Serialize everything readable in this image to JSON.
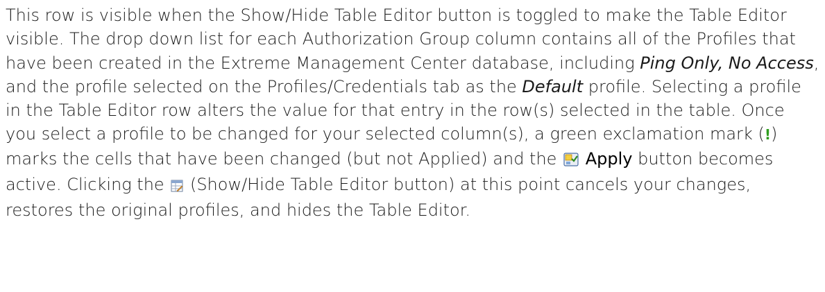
{
  "paragraph": {
    "s1": "This row is visible when the Show/Hide Table Editor button is toggled to make the Table Editor visible. The drop down list for each Authorization Group column contains all of the Profiles that have been created in the Extreme Management Center database, including ",
    "ping_only": "Ping Only, No Access",
    "s2": ", and the profile selected on the Profiles/Credentials tab as the ",
    "default_word": "Default",
    "s3": " profile. Selecting a profile in the Table Editor row alters the value for that entry in the row(s) selected in the table. Once you select a profile to be changed for your selected column(s), a green exclamation mark (",
    "exclamation": "!",
    "s4": ") marks the cells that have been changed (but not Applied) and the ",
    "apply_label": "Apply",
    "s5": " button becomes active. Clicking the ",
    "s6": " (Show/Hide Table Editor button) at this point cancels your changes, restores the original profiles, and hides the Table Editor."
  },
  "icons": {
    "apply": "apply-icon",
    "table_editor": "table-editor-icon",
    "exclamation_color": "#2f9e1f"
  }
}
